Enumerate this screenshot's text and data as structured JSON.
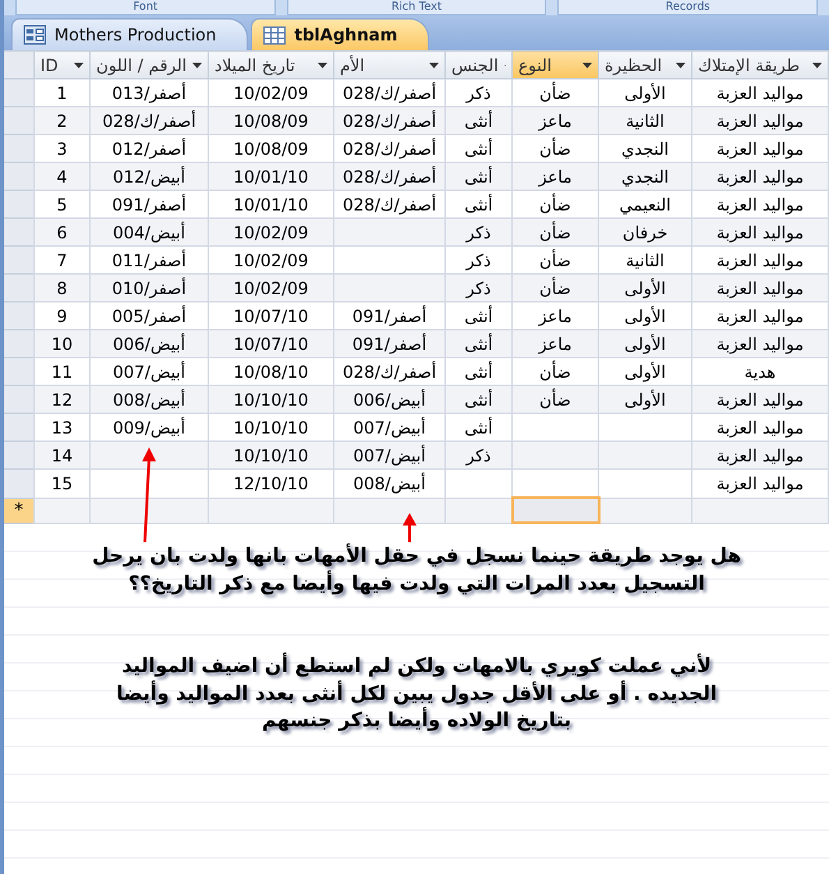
{
  "ribbon_groups": [
    "Records",
    "Rich Text",
    "Font"
  ],
  "tabs": [
    {
      "label": "tblAghnam",
      "kind": "table",
      "selected": true
    },
    {
      "label": "Mothers Production",
      "kind": "form",
      "selected": false
    }
  ],
  "table": {
    "columns": [
      {
        "label": "طريقة الإمتلاك",
        "selected": false
      },
      {
        "label": "الحظيرة",
        "selected": false
      },
      {
        "label": "النوع",
        "selected": true
      },
      {
        "label": "الجنس",
        "selected": false
      },
      {
        "label": "الأم",
        "selected": false
      },
      {
        "label": "تاريخ الميلاد",
        "selected": false
      },
      {
        "label": "الرقم / اللون",
        "selected": false
      },
      {
        "label": "ID",
        "selected": false
      }
    ],
    "rows": [
      [
        "مواليد العزبة",
        "الأولى",
        "ضأن",
        "ذكر",
        "أصفر/ك/028",
        "10/02/09",
        "أصفر/013",
        "1"
      ],
      [
        "مواليد العزبة",
        "الثانية",
        "ماعز",
        "أنثى",
        "أصفر/ك/028",
        "10/08/09",
        "أصفر/ك/028",
        "2"
      ],
      [
        "مواليد العزبة",
        "النجدي",
        "ضأن",
        "أنثى",
        "أصفر/ك/028",
        "10/08/09",
        "أصفر/012",
        "3"
      ],
      [
        "مواليد العزبة",
        "النجدي",
        "ماعز",
        "أنثى",
        "أصفر/ك/028",
        "10/01/10",
        "أبيض/012",
        "4"
      ],
      [
        "مواليد العزبة",
        "النعيمي",
        "ضأن",
        "أنثى",
        "أصفر/ك/028",
        "10/01/10",
        "أصفر/091",
        "5"
      ],
      [
        "مواليد العزبة",
        "خرفان",
        "ضأن",
        "ذكر",
        "",
        "10/02/09",
        "أبيض/004",
        "6"
      ],
      [
        "مواليد العزبة",
        "الثانية",
        "ضأن",
        "ذكر",
        "",
        "10/02/09",
        "أصفر/011",
        "7"
      ],
      [
        "مواليد العزبة",
        "الأولى",
        "ضأن",
        "ذكر",
        "",
        "10/02/09",
        "أصفر/010",
        "8"
      ],
      [
        "مواليد العزبة",
        "الأولى",
        "ماعز",
        "أنثى",
        "أصفر/091",
        "10/07/10",
        "أصفر/005",
        "9"
      ],
      [
        "مواليد العزبة",
        "الأولى",
        "ماعز",
        "أنثى",
        "أصفر/091",
        "10/07/10",
        "أبيض/006",
        "10"
      ],
      [
        "هدية",
        "الأولى",
        "ضأن",
        "أنثى",
        "أصفر/ك/028",
        "10/08/10",
        "أبيض/007",
        "11"
      ],
      [
        "مواليد العزبة",
        "الأولى",
        "ضأن",
        "أنثى",
        "أبيض/006",
        "10/10/10",
        "أبيض/008",
        "12"
      ],
      [
        "مواليد العزبة",
        "",
        "",
        "أنثى",
        "أبيض/007",
        "10/10/10",
        "أبيض/009",
        "13"
      ],
      [
        "مواليد العزبة",
        "",
        "",
        "ذكر",
        "أبيض/007",
        "10/10/10",
        "",
        "14"
      ],
      [
        "مواليد العزبة",
        "",
        "",
        "",
        "أبيض/008",
        "12/10/10",
        "",
        "15"
      ]
    ],
    "new_row_marker": "*"
  },
  "notes": [
    "هل يوجد طريقة حينما نسجل في حقل الأمهات بانها ولدت بان يرحل التسجيل بعدد المرات التي ولدت فيها وأيضا مع ذكر التاريخ؟؟",
    "لأني عملت كويري بالامهات ولكن لم استطع أن اضيف المواليد الجديده . أو على الأقل جدول يبين لكل أنثى بعدد المواليد وأيضا بتاريخ الولاده وأيضا بذكر جنسهم"
  ]
}
